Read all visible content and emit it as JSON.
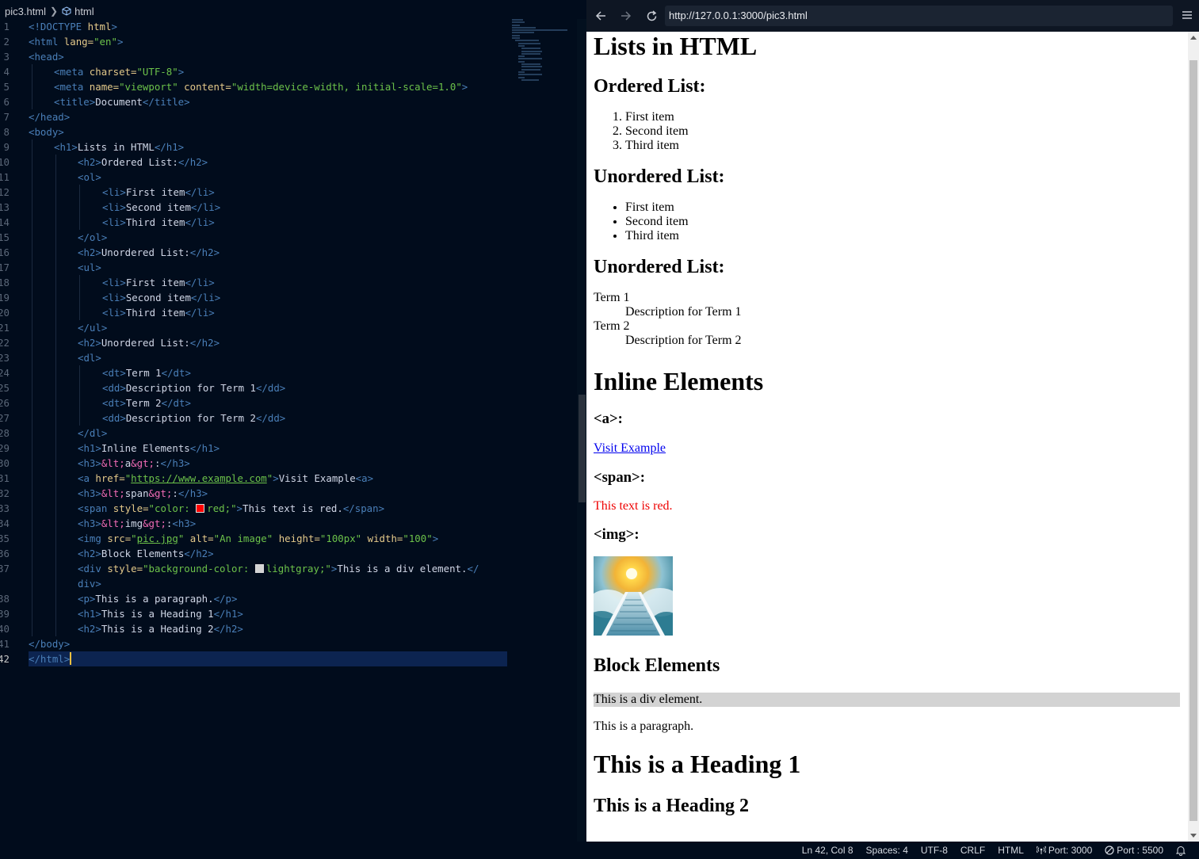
{
  "editor": {
    "breadcrumb": {
      "file": "pic3.html",
      "symbol": "html"
    },
    "lines": [
      {
        "n": "1"
      },
      {
        "n": "2"
      },
      {
        "n": "3"
      },
      {
        "n": "4"
      },
      {
        "n": "5"
      },
      {
        "n": "6"
      },
      {
        "n": "7"
      },
      {
        "n": "8"
      },
      {
        "n": "9"
      },
      {
        "n": "10"
      },
      {
        "n": "11"
      },
      {
        "n": "12"
      },
      {
        "n": "13"
      },
      {
        "n": "14"
      },
      {
        "n": "15"
      },
      {
        "n": "16"
      },
      {
        "n": "17"
      },
      {
        "n": "18"
      },
      {
        "n": "19"
      },
      {
        "n": "20"
      },
      {
        "n": "21"
      },
      {
        "n": "22"
      },
      {
        "n": "23"
      },
      {
        "n": "24"
      },
      {
        "n": "25"
      },
      {
        "n": "26"
      },
      {
        "n": "27"
      },
      {
        "n": "28"
      },
      {
        "n": "29"
      },
      {
        "n": "30"
      },
      {
        "n": "31"
      },
      {
        "n": "32"
      },
      {
        "n": "33"
      },
      {
        "n": "34"
      },
      {
        "n": "35"
      },
      {
        "n": "36"
      },
      {
        "n": "37"
      },
      {
        "n": ""
      },
      {
        "n": "38"
      },
      {
        "n": "39"
      },
      {
        "n": "40"
      },
      {
        "n": "41"
      },
      {
        "n": "42"
      }
    ],
    "code": {
      "doctype": "<!DOCTYPE",
      "html": "html",
      "html_open": "<html",
      "lang_attr": "lang=",
      "lang_val": "\"en\"",
      "head_open": "<head>",
      "meta": "<meta",
      "charset_attr": "charset=",
      "charset_val": "\"UTF-8\"",
      "name_attr": "name=",
      "name_val": "\"viewport\"",
      "content_attr": "content=",
      "content_val": "\"width=device-width, initial-scale=1.0\"",
      "title_open": "<title>",
      "title_text": "Document",
      "title_close": "</title>",
      "head_close": "</head>",
      "body_open": "<body>",
      "h1_open": "<h1>",
      "h1_close": "</h1>",
      "h1_text": "Lists in HTML",
      "h2_open": "<h2>",
      "h2_close": "</h2>",
      "ordered_list": "Ordered List:",
      "ol_open": "<ol>",
      "ol_close": "</ol>",
      "li_open": "<li>",
      "li_close": "</li>",
      "first_item": "First item",
      "second_item": "Second item",
      "third_item": "Third item",
      "unordered_list": "Unordered List:",
      "ul_open": "<ul>",
      "ul_close": "</ul>",
      "dl_open": "<dl>",
      "dl_close": "</dl>",
      "dt_open": "<dt>",
      "dt_close": "</dt>",
      "dd_open": "<dd>",
      "dd_close": "</dd>",
      "term1": "Term 1",
      "term2": "Term 2",
      "desc1": "Description for Term 1",
      "desc2": "Description for Term 2",
      "inline_elements": "Inline Elements",
      "h3_open": "<h3>",
      "h3_close": "</h3>",
      "h3_close_bad": "<h3>",
      "ent_lt": "&lt;",
      "ent_gt": "&gt;",
      "a_tag": "a",
      "span_tag": "span",
      "img_tag": "img",
      "colon": ":",
      "a_open": "<a",
      "href_attr": "href=",
      "q": "\"",
      "href_val": "https://www.example.com",
      "gt": ">",
      "visit_text": "Visit Example",
      "a_close_bad": "<a>",
      "span_open": "<span",
      "style_attr": "style=",
      "color_prop": "\"color: ",
      "red_val": "red;\"",
      "red_text": "This text is red.",
      "span_close": "</span>",
      "img_open": "<img",
      "src_attr": "src=",
      "src_val": "pic.jpg",
      "alt_attr": "alt=",
      "alt_val": "\"An image\"",
      "height_attr": "height=",
      "height_val": "\"100px\"",
      "width_attr": "width=",
      "width_val": "\"100\"",
      "block_elements": "Block Elements",
      "div_open": "<div",
      "bg_prop": "\"background-color: ",
      "lightgray_val": "lightgray;\"",
      "div_text": "This is a div element.",
      "div_close_a": "</",
      "div_close_b": "div>",
      "p_open": "<p>",
      "p_close": "</p>",
      "para_text": "This is a paragraph.",
      "heading1_text": "This is a Heading 1",
      "heading2_text": "This is a Heading 2",
      "body_close": "</body>",
      "html_close": "</html>"
    },
    "colors": {
      "red_swatch": "#ff0000",
      "lightgray_swatch": "#d3d3d3"
    }
  },
  "browser": {
    "url": "http://127.0.0.1:3000/pic3.html",
    "icons": [
      "back-arrow-icon",
      "forward-arrow-icon",
      "reload-icon",
      "hamburger-menu-icon"
    ],
    "page": {
      "title": "Lists in HTML",
      "ordered_heading": "Ordered List:",
      "ordered_items": [
        "First item",
        "Second item",
        "Third item"
      ],
      "unordered_heading": "Unordered List:",
      "unordered_items": [
        "First item",
        "Second item",
        "Third item"
      ],
      "dl_heading": "Unordered List:",
      "term1": "Term 1",
      "desc1": "Description for Term 1",
      "term2": "Term 2",
      "desc2": "Description for Term 2",
      "inline_heading": "Inline Elements",
      "a_heading": "<a>:",
      "link_text": "Visit Example",
      "span_heading": "<span>:",
      "red_text": "This text is red.",
      "img_heading": "<img>:",
      "block_heading": "Block Elements",
      "div_text": "This is a div element.",
      "paragraph": "This is a paragraph.",
      "heading1": "This is a Heading 1",
      "heading2": "This is a Heading 2"
    }
  },
  "status_bar": {
    "position": "Ln 42, Col 8",
    "spaces": "Spaces: 4",
    "encoding": "UTF-8",
    "eol": "CRLF",
    "language": "HTML",
    "port1": "Port: 3000",
    "port2": "Port : 5500"
  }
}
